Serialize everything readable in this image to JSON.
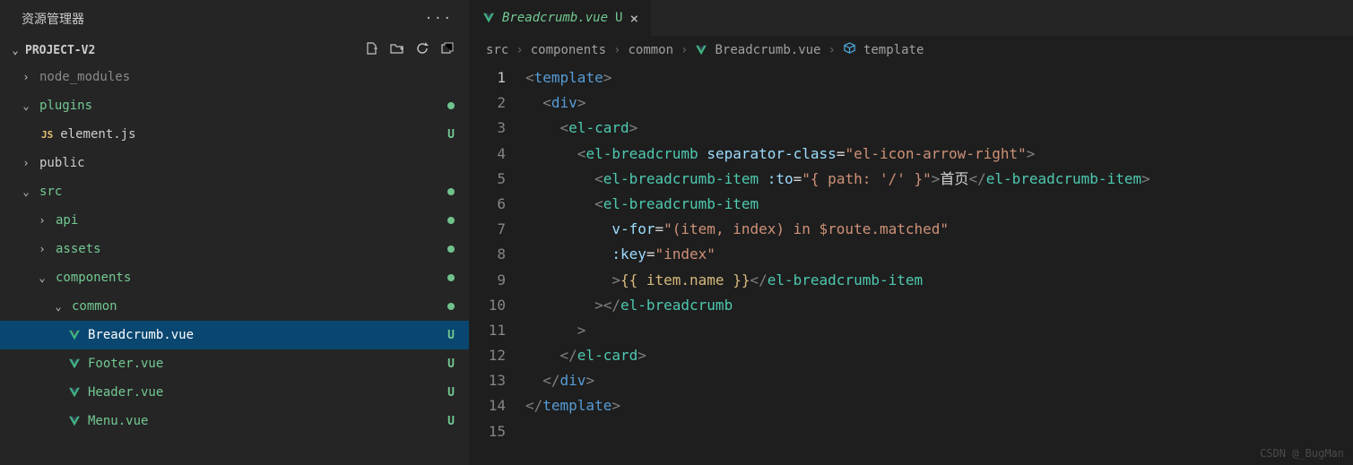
{
  "sidebar": {
    "title": "资源管理器",
    "project": "PROJECT-V2",
    "items": [
      {
        "label": "node_modules",
        "indent": 22,
        "chev": "›",
        "class": "dim"
      },
      {
        "label": "plugins",
        "indent": 22,
        "chev": "⌄",
        "class": "green",
        "dot": true
      },
      {
        "label": "element.js",
        "indent": 46,
        "icon": "js",
        "u": true
      },
      {
        "label": "public",
        "indent": 22,
        "chev": "›"
      },
      {
        "label": "src",
        "indent": 22,
        "chev": "⌄",
        "class": "green",
        "dot": true
      },
      {
        "label": "api",
        "indent": 40,
        "chev": "›",
        "class": "green",
        "dot": true
      },
      {
        "label": "assets",
        "indent": 40,
        "chev": "›",
        "class": "green",
        "dot": true
      },
      {
        "label": "components",
        "indent": 40,
        "chev": "⌄",
        "class": "green",
        "dot": true
      },
      {
        "label": "common",
        "indent": 58,
        "chev": "⌄",
        "class": "green",
        "dot": true
      },
      {
        "label": "Breadcrumb.vue",
        "indent": 76,
        "icon": "vue",
        "u": true,
        "selected": true,
        "lightlabel": true
      },
      {
        "label": "Footer.vue",
        "indent": 76,
        "icon": "vue",
        "class": "green",
        "u": true
      },
      {
        "label": "Header.vue",
        "indent": 76,
        "icon": "vue",
        "class": "green",
        "u": true
      },
      {
        "label": "Menu.vue",
        "indent": 76,
        "icon": "vue",
        "class": "green",
        "u": true
      }
    ]
  },
  "tab": {
    "label": "Breadcrumb.vue",
    "status": "U"
  },
  "breadcrumb": [
    "src",
    "components",
    "common",
    "Breadcrumb.vue",
    "template"
  ],
  "code": {
    "lines": [
      [
        [
          "p-gray",
          "<"
        ],
        [
          "p-tag",
          "template"
        ],
        [
          "p-gray",
          ">"
        ]
      ],
      [
        [
          "",
          "  "
        ],
        [
          "p-gray",
          "<"
        ],
        [
          "p-tag",
          "div"
        ],
        [
          "p-gray",
          ">"
        ]
      ],
      [
        [
          "",
          "    "
        ],
        [
          "p-gray",
          "<"
        ],
        [
          "p-comp",
          "el-card"
        ],
        [
          "p-gray",
          ">"
        ]
      ],
      [
        [
          "",
          "      "
        ],
        [
          "p-gray",
          "<"
        ],
        [
          "p-comp",
          "el-breadcrumb"
        ],
        [
          "",
          " "
        ],
        [
          "p-attr",
          "separator-class"
        ],
        [
          "p-text",
          "="
        ],
        [
          "p-str",
          "\"el-icon-arrow-right\""
        ],
        [
          "p-gray",
          ">"
        ]
      ],
      [
        [
          "",
          "        "
        ],
        [
          "p-gray",
          "<"
        ],
        [
          "p-comp",
          "el-breadcrumb-item"
        ],
        [
          "",
          " "
        ],
        [
          "p-attr",
          ":to"
        ],
        [
          "p-text",
          "="
        ],
        [
          "p-str",
          "\"{ path: '/' }\""
        ],
        [
          "p-gray",
          ">"
        ],
        [
          "p-text",
          "首页"
        ],
        [
          "p-gray",
          "</"
        ],
        [
          "p-comp",
          "el-breadcrumb-item"
        ],
        [
          "p-gray",
          ">"
        ]
      ],
      [
        [
          "",
          "        "
        ],
        [
          "p-gray",
          "<"
        ],
        [
          "p-comp",
          "el-breadcrumb-item"
        ]
      ],
      [
        [
          "",
          "          "
        ],
        [
          "p-attr",
          "v-for"
        ],
        [
          "p-text",
          "="
        ],
        [
          "p-str",
          "\"(item, index) in $route.matched\""
        ]
      ],
      [
        [
          "",
          "          "
        ],
        [
          "p-attr",
          ":key"
        ],
        [
          "p-text",
          "="
        ],
        [
          "p-str",
          "\"index\""
        ]
      ],
      [
        [
          "",
          "          "
        ],
        [
          "p-gray",
          ">"
        ],
        [
          "p-brace",
          "{{ item.name }}"
        ],
        [
          "p-gray",
          "</"
        ],
        [
          "p-comp",
          "el-breadcrumb-item"
        ]
      ],
      [
        [
          "",
          "        "
        ],
        [
          "p-gray",
          "></"
        ],
        [
          "p-comp",
          "el-breadcrumb"
        ]
      ],
      [
        [
          "",
          "      "
        ],
        [
          "p-gray",
          ">"
        ]
      ],
      [
        [
          "",
          "    "
        ],
        [
          "p-gray",
          "</"
        ],
        [
          "p-comp",
          "el-card"
        ],
        [
          "p-gray",
          ">"
        ]
      ],
      [
        [
          "",
          "  "
        ],
        [
          "p-gray",
          "</"
        ],
        [
          "p-tag",
          "div"
        ],
        [
          "p-gray",
          ">"
        ]
      ],
      [
        [
          "p-gray",
          "</"
        ],
        [
          "p-tag",
          "template"
        ],
        [
          "p-gray",
          ">"
        ]
      ],
      []
    ]
  },
  "watermark": "CSDN @_BugMan"
}
